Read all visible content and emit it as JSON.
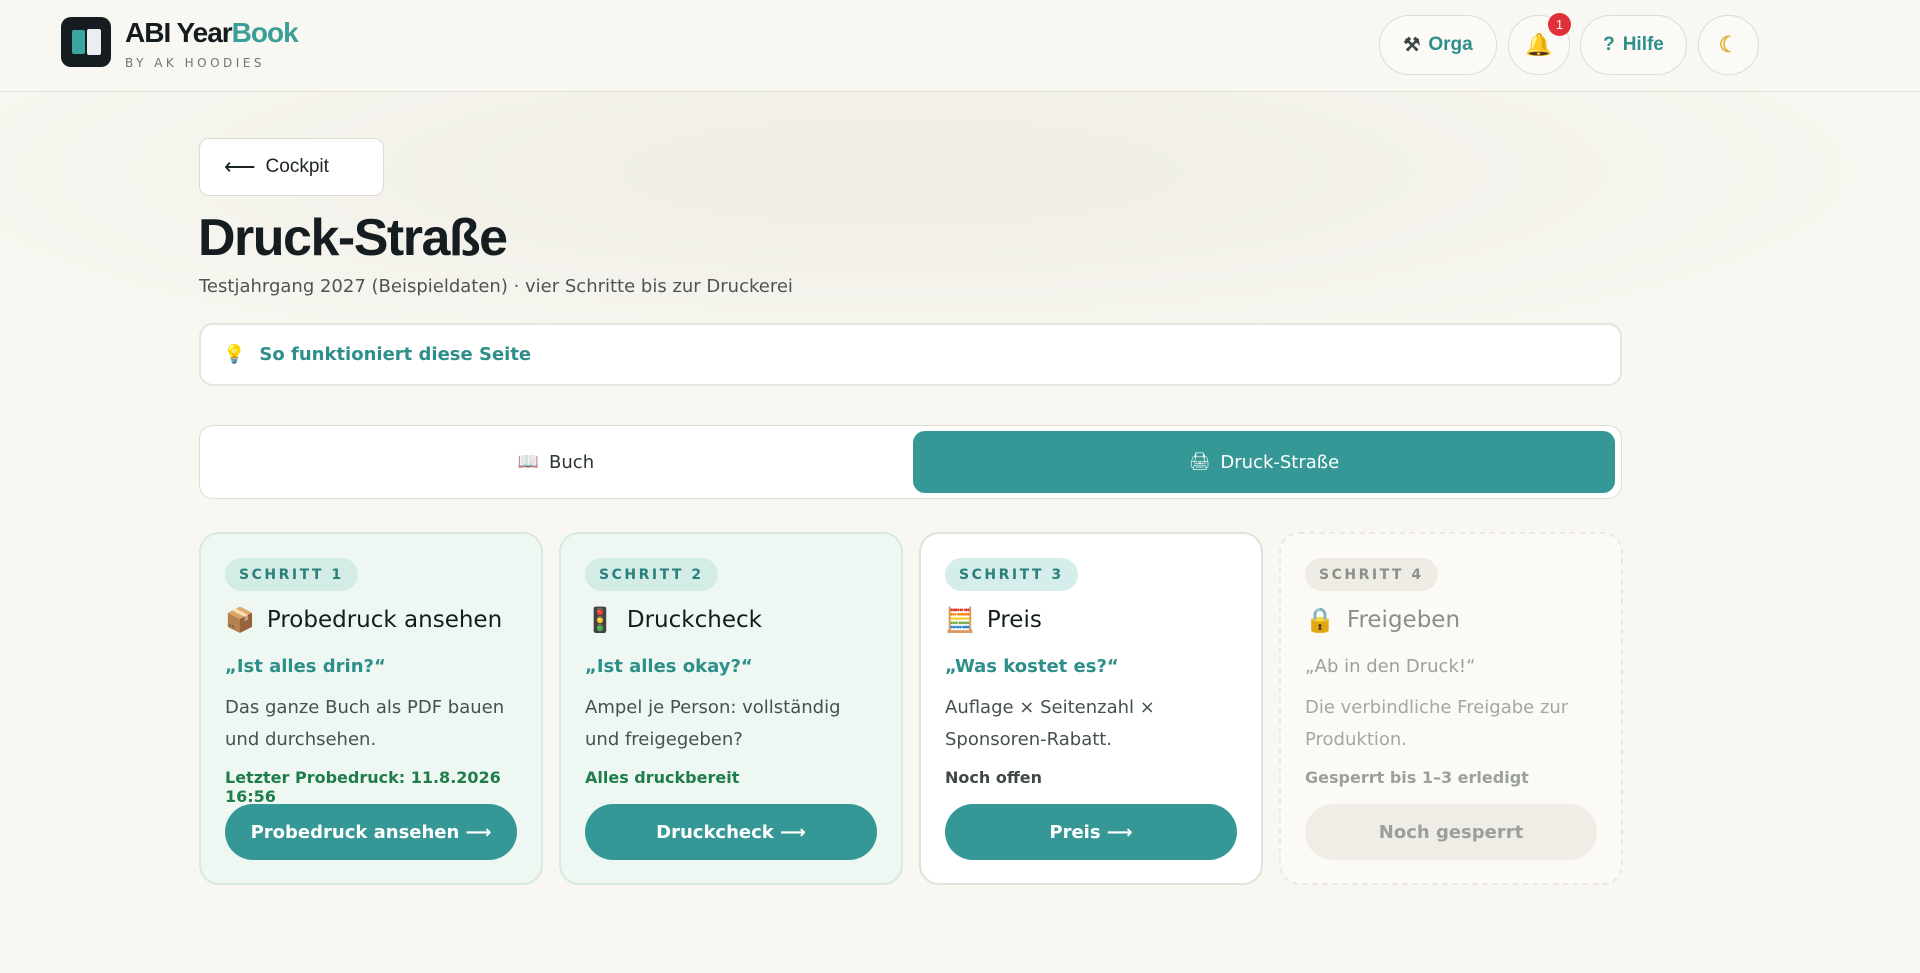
{
  "header": {
    "brand_main": "ABI Year",
    "brand_accent": "Book",
    "brand_sub": "BY AK HOODIES",
    "orga_label": "Orga",
    "orga_icon": "tools-icon",
    "notification_count": "1",
    "hilfe_label": "Hilfe",
    "hilfe_icon": "?",
    "theme_icon": "moon-icon"
  },
  "back": {
    "arrow": "⟵",
    "label": "Cockpit"
  },
  "page": {
    "title": "Druck-Straße",
    "subtitle": "Testjahrgang 2027 (Beispieldaten) · vier Schritte bis zur Druckerei"
  },
  "help": {
    "label": "So funktioniert diese Seite"
  },
  "tabs": [
    {
      "label": "Buch",
      "icon": "📖",
      "active": false
    },
    {
      "label": "Druck-Straße",
      "icon": "🖨",
      "active": true
    }
  ],
  "steps": [
    {
      "step": "SCHRITT 1",
      "icon": "📦",
      "title": "Probedruck ansehen",
      "quote": "„Ist alles drin?“",
      "desc": "Das ganze Buch als PDF bauen und durchsehen.",
      "status": "Letzter Probedruck: 11.8.2026 16:56",
      "button": "Probedruck ansehen ⟶"
    },
    {
      "step": "SCHRITT 2",
      "icon": "🚦",
      "title": "Druckcheck",
      "quote": "„Ist alles okay?“",
      "desc": "Ampel je Person: vollständig und freigegeben?",
      "status": "Alles druckbereit",
      "button": "Druckcheck ⟶"
    },
    {
      "step": "SCHRITT 3",
      "icon": "🧮",
      "title": "Preis",
      "quote": "„Was kostet es?“",
      "desc": "Auflage × Seitenzahl × Sponsoren-Rabatt.",
      "status": "Noch offen",
      "button": "Preis ⟶"
    },
    {
      "step": "SCHRITT 4",
      "icon": "🔒",
      "title": "Freigeben",
      "quote": "„Ab in den Druck!“",
      "desc": "Die verbindliche Freigabe zur Produktion.",
      "status": "Gesperrt bis 1–3 erledigt",
      "button": "Noch gesperrt"
    }
  ],
  "colors": {
    "accent": "#359896",
    "background": "#f8f7f1",
    "success_text": "#1f7d4c",
    "badge": "#e0303a"
  }
}
